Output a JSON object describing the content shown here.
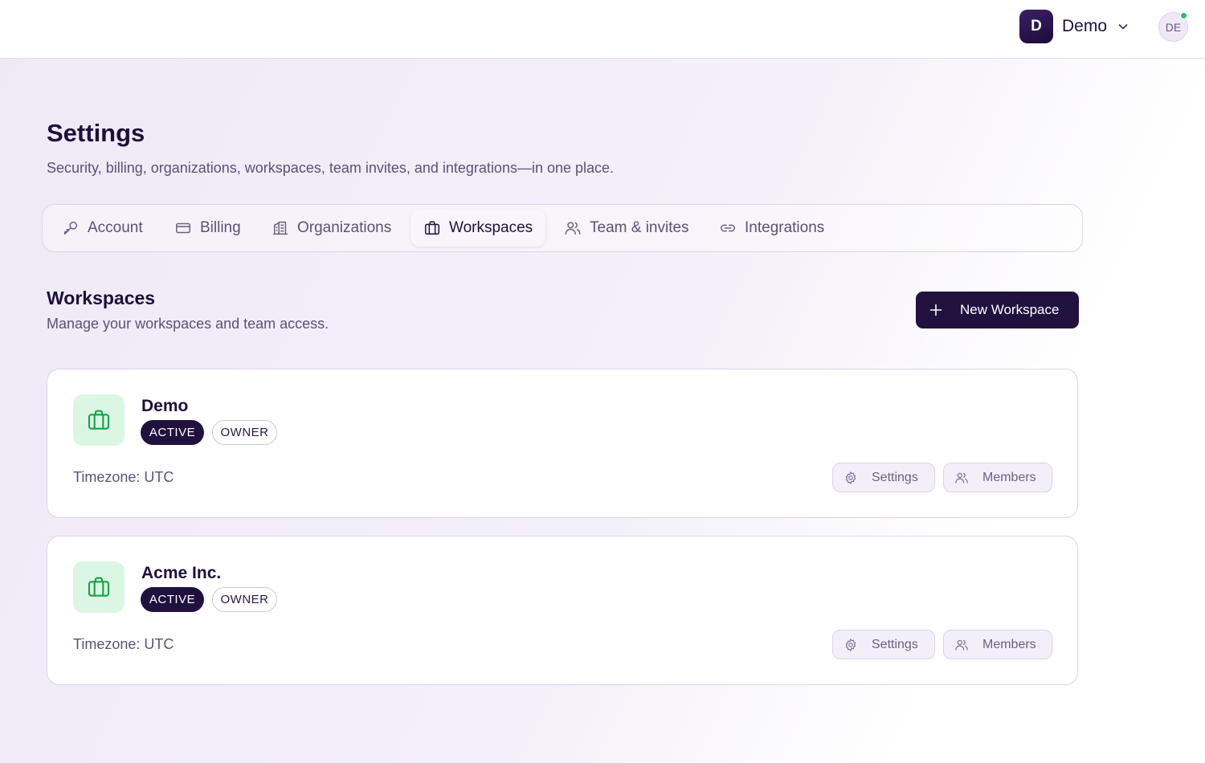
{
  "topbar": {
    "workspace_initial": "D",
    "workspace_name": "Demo",
    "user_initials": "DE"
  },
  "header": {
    "title": "Settings",
    "subtitle": "Security, billing, organizations, workspaces, team invites, and integrations—in one place."
  },
  "tabs": [
    {
      "label": "Account",
      "icon": "key-icon",
      "active": false
    },
    {
      "label": "Billing",
      "icon": "credit-card-icon",
      "active": false
    },
    {
      "label": "Organizations",
      "icon": "building-icon",
      "active": false
    },
    {
      "label": "Workspaces",
      "icon": "briefcase-icon",
      "active": true
    },
    {
      "label": "Team & invites",
      "icon": "users-icon",
      "active": false
    },
    {
      "label": "Integrations",
      "icon": "link-icon",
      "active": false
    }
  ],
  "section": {
    "title": "Workspaces",
    "subtitle": "Manage your workspaces and team access.",
    "new_button_label": "New Workspace"
  },
  "workspaces": [
    {
      "name": "Demo",
      "status_badge": "ACTIVE",
      "role_badge": "OWNER",
      "timezone": "Timezone: UTC",
      "settings_label": "Settings",
      "members_label": "Members"
    },
    {
      "name": "Acme Inc.",
      "status_badge": "ACTIVE",
      "role_badge": "OWNER",
      "timezone": "Timezone: UTC",
      "settings_label": "Settings",
      "members_label": "Members"
    }
  ],
  "colors": {
    "brand_dark": "#21113f",
    "icon_green": "#16a34a",
    "icon_bg_green": "#dcf6e4",
    "online": "#22c55e"
  }
}
